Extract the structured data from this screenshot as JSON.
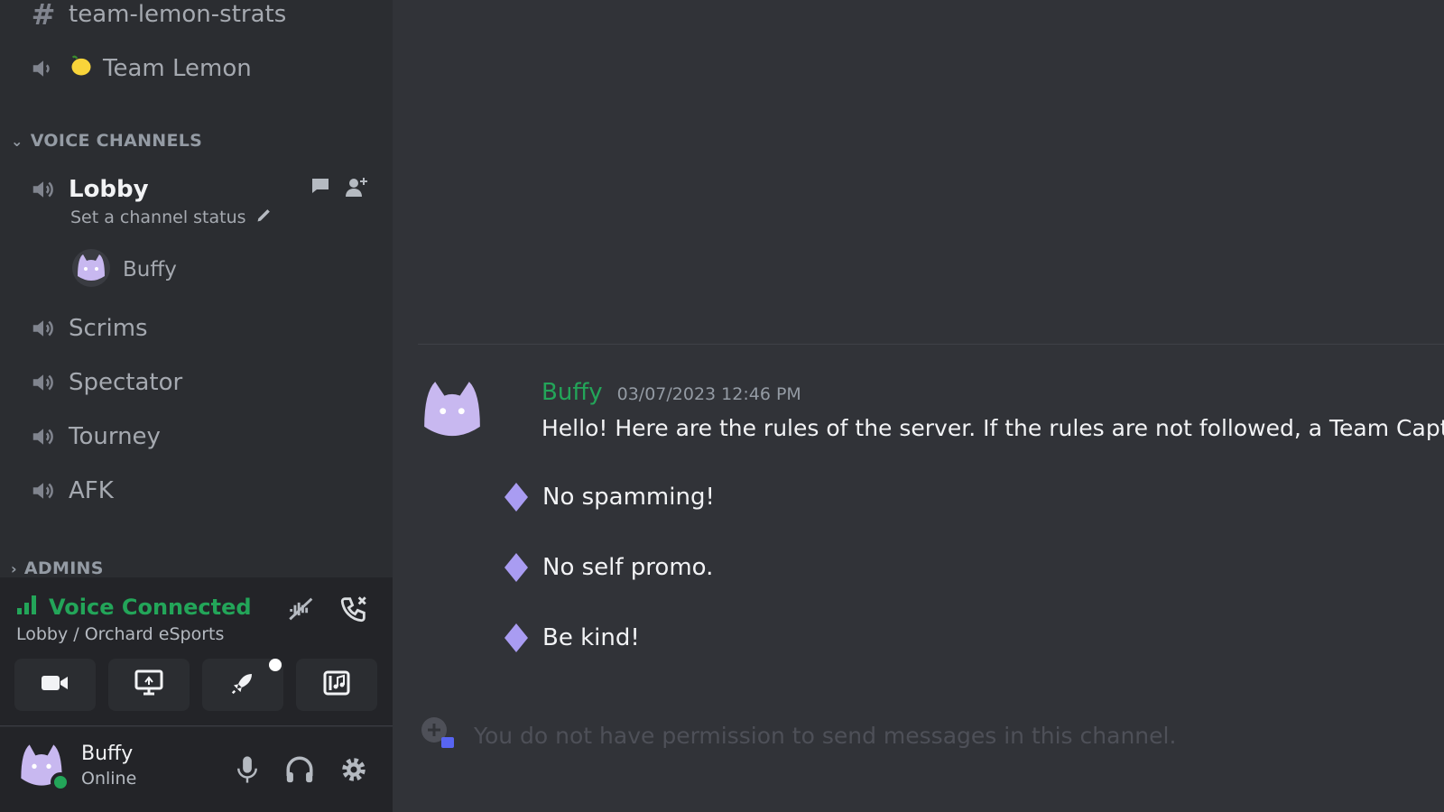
{
  "sidebar": {
    "text_channel": {
      "name": "team-lemon-strats"
    },
    "team_lemon": {
      "name": "Team Lemon"
    },
    "voice_category": "VOICE CHANNELS",
    "lobby": {
      "name": "Lobby",
      "status_placeholder": "Set a channel status",
      "member": "Buffy"
    },
    "voice_channels": [
      "Scrims",
      "Spectator",
      "Tourney",
      "AFK"
    ],
    "admins_category": "ADMINS"
  },
  "voice_panel": {
    "title": "Voice Connected",
    "subtitle": "Lobby / Orchard eSports"
  },
  "user_panel": {
    "name": "Buffy",
    "status": "Online"
  },
  "message": {
    "author": "Buffy",
    "timestamp": "03/07/2023 12:46 PM",
    "text": "Hello! Here are the rules of the server. If the rules are not followed, a Team Captain wi",
    "rules": [
      "No spamming!",
      "No self promo.",
      "Be kind!"
    ]
  },
  "composer": {
    "placeholder": "You do not have permission to send messages in this channel."
  },
  "colors": {
    "online_green": "#23a559",
    "rule_diamond": "#a99cf2",
    "avatar": "#c8b8f0"
  }
}
